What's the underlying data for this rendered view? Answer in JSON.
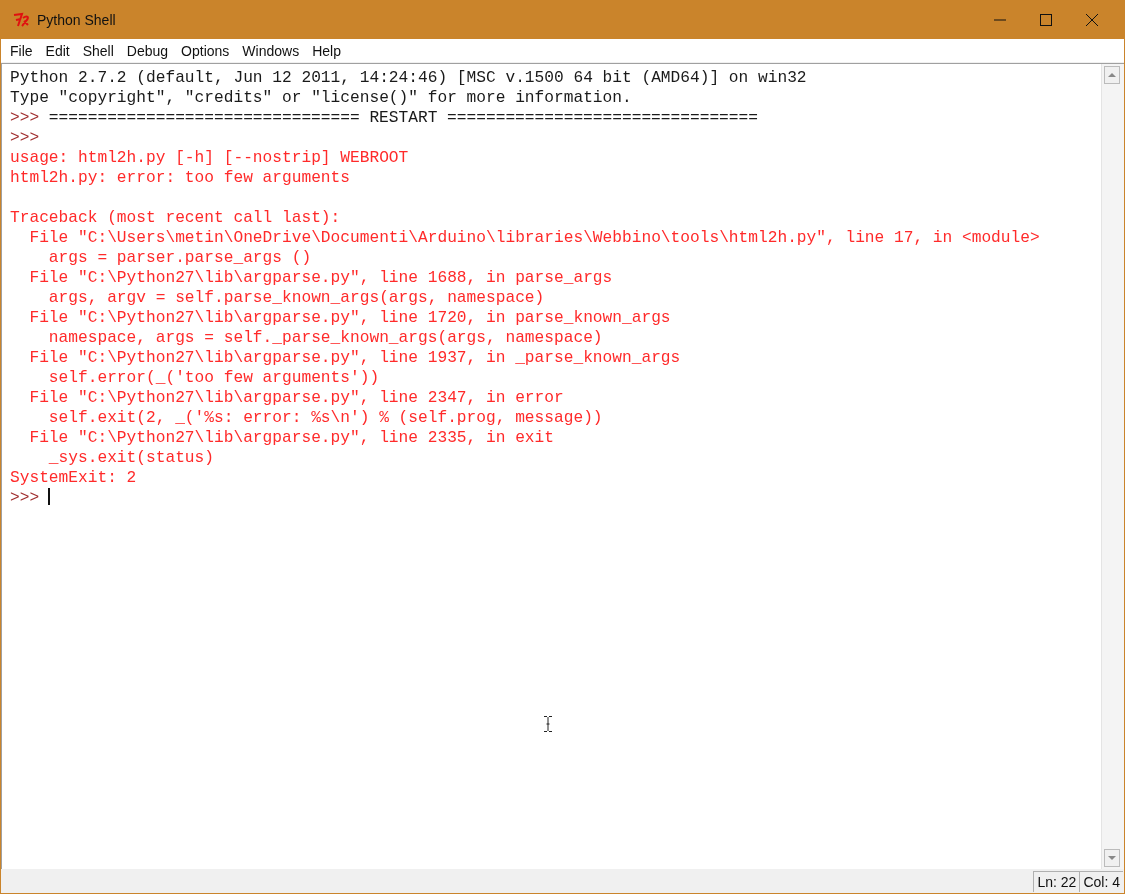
{
  "window": {
    "title": "Python Shell"
  },
  "menu": [
    "File",
    "Edit",
    "Shell",
    "Debug",
    "Options",
    "Windows",
    "Help"
  ],
  "shell_lines": [
    {
      "kind": "output",
      "text": "Python 2.7.2 (default, Jun 12 2011, 14:24:46) [MSC v.1500 64 bit (AMD64)] on win32"
    },
    {
      "kind": "output",
      "text": "Type \"copyright\", \"credits\" or \"license()\" for more information."
    },
    {
      "kind": "prompt",
      "prompt": ">>>",
      "text": "================================ RESTART ================================"
    },
    {
      "kind": "prompt",
      "prompt": ">>>"
    },
    {
      "kind": "error",
      "text": "usage: html2h.py [-h] [--nostrip] WEBROOT"
    },
    {
      "kind": "error",
      "text": "html2h.py: error: too few arguments"
    },
    {
      "kind": "blank"
    },
    {
      "kind": "error",
      "text": "Traceback (most recent call last):"
    },
    {
      "kind": "error",
      "text": "  File \"C:\\Users\\metin\\OneDrive\\Documenti\\Arduino\\libraries\\Webbino\\tools\\html2h.py\", line 17, in <module>"
    },
    {
      "kind": "error",
      "text": "    args = parser.parse_args ()"
    },
    {
      "kind": "error",
      "text": "  File \"C:\\Python27\\lib\\argparse.py\", line 1688, in parse_args"
    },
    {
      "kind": "error",
      "text": "    args, argv = self.parse_known_args(args, namespace)"
    },
    {
      "kind": "error",
      "text": "  File \"C:\\Python27\\lib\\argparse.py\", line 1720, in parse_known_args"
    },
    {
      "kind": "error",
      "text": "    namespace, args = self._parse_known_args(args, namespace)"
    },
    {
      "kind": "error",
      "text": "  File \"C:\\Python27\\lib\\argparse.py\", line 1937, in _parse_known_args"
    },
    {
      "kind": "error",
      "text": "    self.error(_('too few arguments'))"
    },
    {
      "kind": "error",
      "text": "  File \"C:\\Python27\\lib\\argparse.py\", line 2347, in error"
    },
    {
      "kind": "error",
      "text": "    self.exit(2, _('%s: error: %s\\n') % (self.prog, message))"
    },
    {
      "kind": "error",
      "text": "  File \"C:\\Python27\\lib\\argparse.py\", line 2335, in exit"
    },
    {
      "kind": "error",
      "text": "    _sys.exit(status)"
    },
    {
      "kind": "error",
      "text": "SystemExit: 2"
    },
    {
      "kind": "input",
      "prompt": ">>>"
    }
  ],
  "status_bar": {
    "line": "Ln: 22",
    "column": "Col: 4"
  }
}
